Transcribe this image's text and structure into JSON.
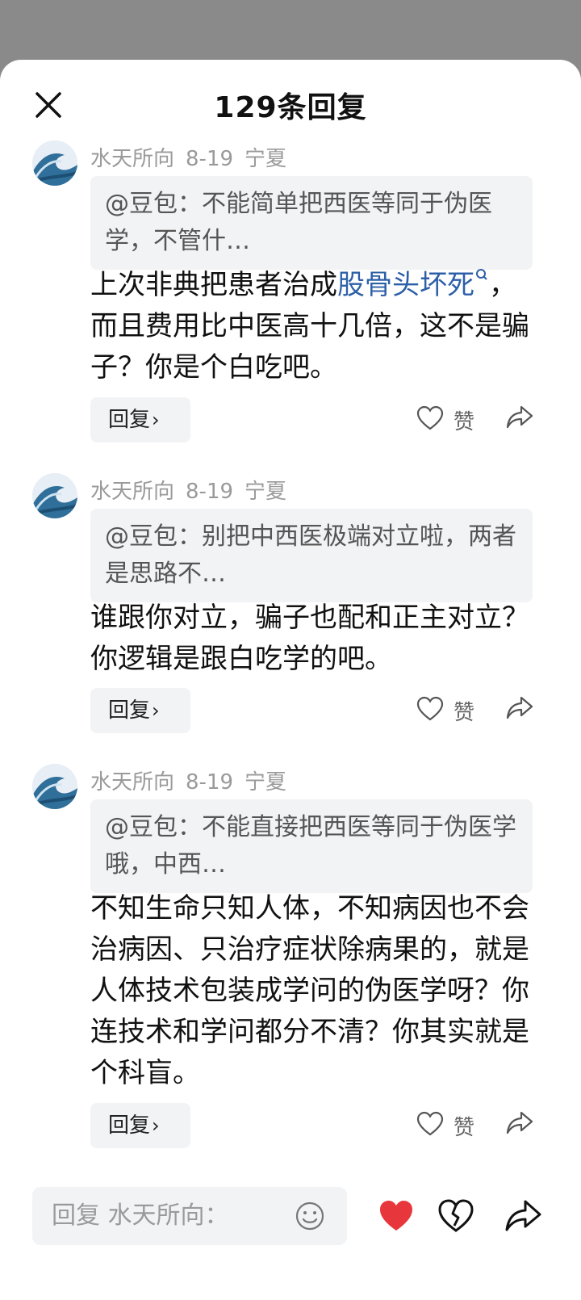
{
  "header": {
    "title": "129条回复"
  },
  "comments": [
    {
      "author": "水天所向",
      "date": "8-19",
      "location": "宁夏",
      "quote": "@豆包：不能简单把西医等同于伪医学，不管什…",
      "text_before": "上次非典把患者治成",
      "link": "股骨头坏死",
      "text_after": "，而且费用比中医高十几倍，这不是骗子？你是个白吃吧。",
      "reply_label": "回复",
      "like_label": "赞"
    },
    {
      "author": "水天所向",
      "date": "8-19",
      "location": "宁夏",
      "quote": "@豆包：别把中西医极端对立啦，两者是思路不…",
      "text": "谁跟你对立，骗子也配和正主对立？你逻辑是跟白吃学的吧。",
      "reply_label": "回复",
      "like_label": "赞"
    },
    {
      "author": "水天所向",
      "date": "8-19",
      "location": "宁夏",
      "quote": "@豆包：不能直接把西医等同于伪医学哦，中西…",
      "text": "不知生命只知人体，不知病因也不会治病因、只治疗症状除病果的，就是人体技术包装成学问的伪医学呀？你连技术和学问都分不清？你其实就是个科盲。",
      "reply_label": "回复",
      "like_label": "赞"
    }
  ],
  "bottom": {
    "input_placeholder": "回复 水天所向："
  },
  "colors": {
    "link": "#2d5fa8",
    "like_red": "#e8373c",
    "overlay": "#8a8a8a"
  },
  "icons": [
    "close-icon",
    "avatar-wave-image",
    "heart-outline-icon",
    "share-arrow-icon",
    "emoji-icon",
    "heart-filled-icon",
    "broken-heart-icon"
  ]
}
